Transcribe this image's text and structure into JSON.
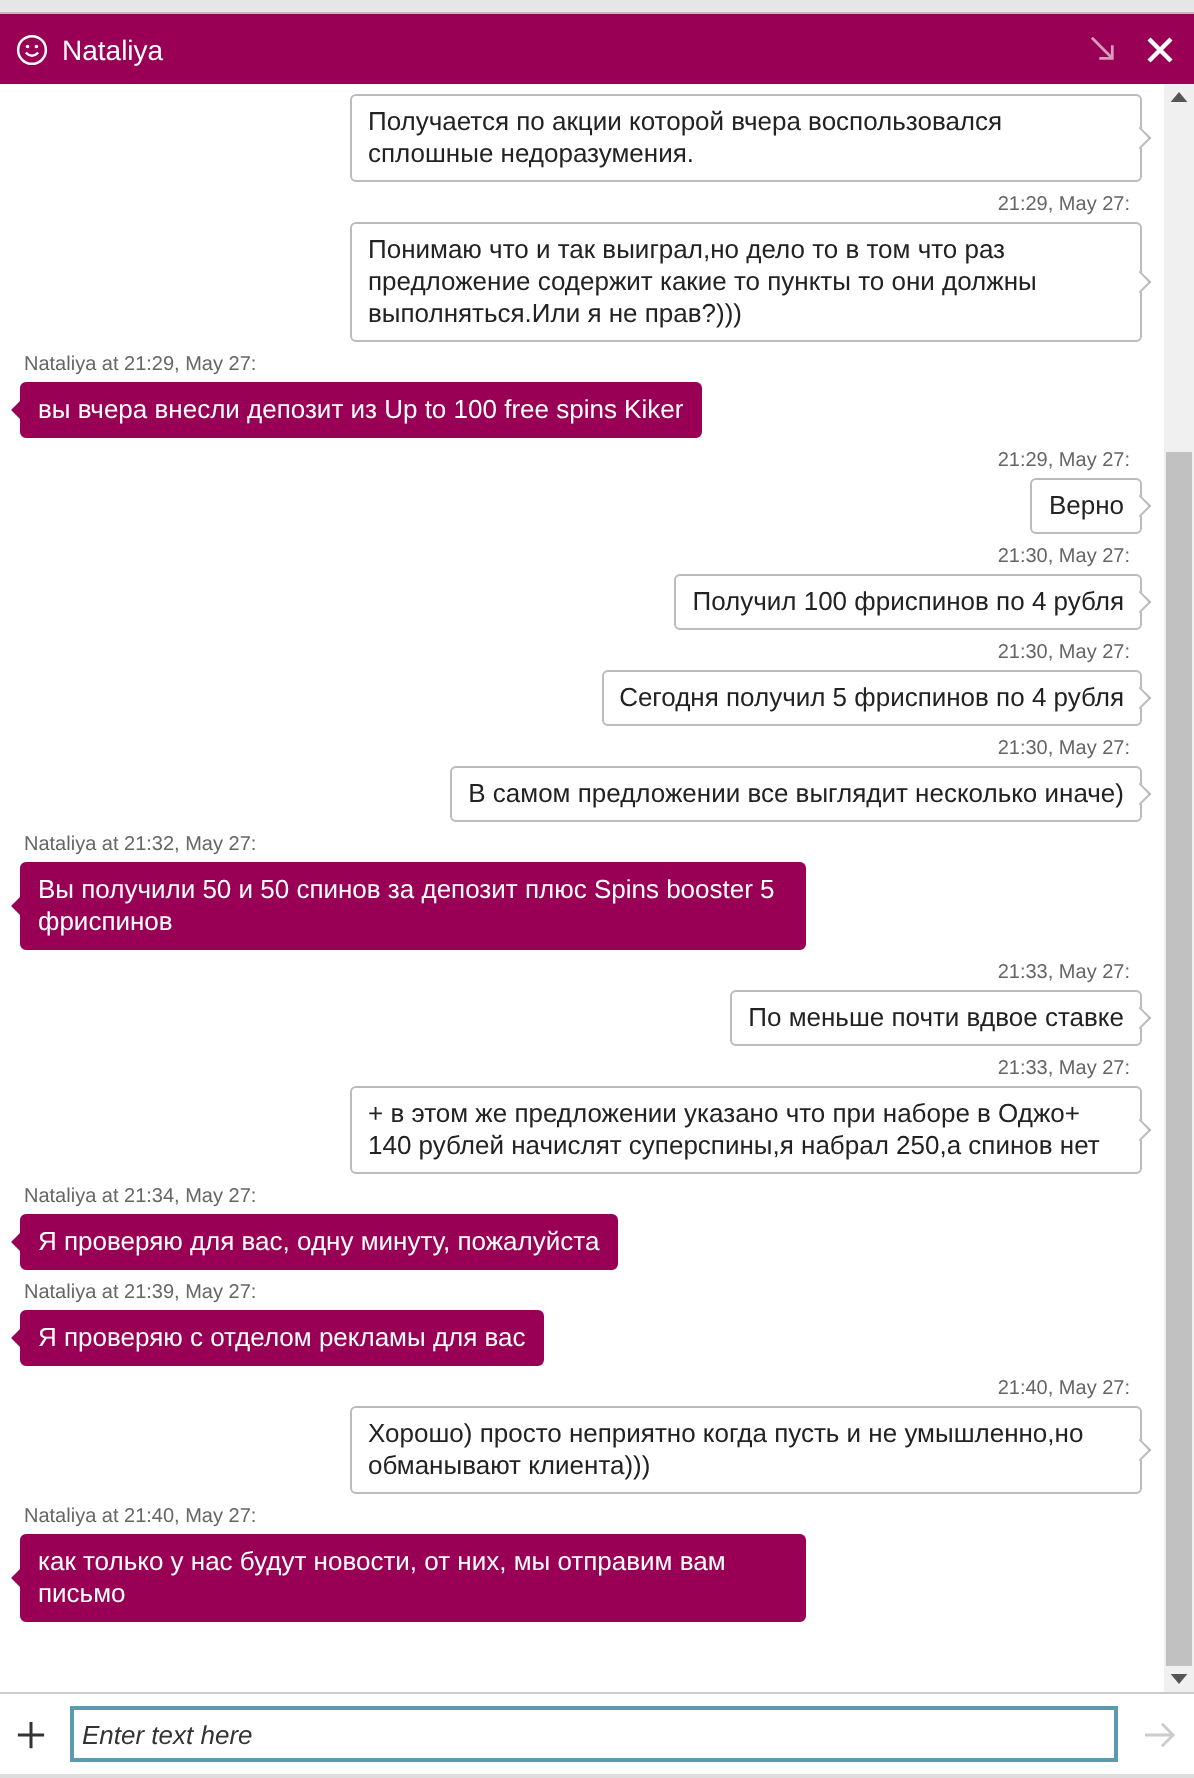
{
  "header": {
    "title": "Nataliya"
  },
  "messages": [
    {
      "kind": "user",
      "text": "Получается по акции которой вчера воспользовался сплошные недоразумения."
    },
    {
      "kind": "user",
      "time": "21:29, May 27:",
      "text": "Понимаю что и так выиграл,но дело то в том что раз предложение содержит какие то пункты то они должны выполняться.Или я не прав?)))"
    },
    {
      "kind": "agent",
      "time": "Nataliya at 21:29, May 27:",
      "text": "вы вчера внесли депозит из Up to 100 free spins Kiker"
    },
    {
      "kind": "user",
      "time": "21:29, May 27:",
      "text": "Верно"
    },
    {
      "kind": "user",
      "time": "21:30, May 27:",
      "text": "Получил 100 фриспинов по 4 рубля"
    },
    {
      "kind": "user",
      "time": "21:30, May 27:",
      "text": "Сегодня получил 5 фриспинов по 4 рубля"
    },
    {
      "kind": "user",
      "time": "21:30, May 27:",
      "text": "В самом предложении все выглядит несколько иначе)"
    },
    {
      "kind": "agent",
      "time": "Nataliya at 21:32, May 27:",
      "text": "Вы получили 50 и 50 спинов за депозит плюс Spins booster 5 фриспинов"
    },
    {
      "kind": "user",
      "time": "21:33, May 27:",
      "text": "По меньше почти вдвое ставке"
    },
    {
      "kind": "user",
      "time": "21:33, May 27:",
      "text": "+ в этом же предложении указано что при наборе в Оджо+ 140 рублей начислят суперспины,я набрал 250,а спинов нет"
    },
    {
      "kind": "agent",
      "time": "Nataliya at 21:34, May 27:",
      "text": "Я проверяю для вас, одну минуту, пожалуйста"
    },
    {
      "kind": "agent",
      "time": "Nataliya at 21:39, May 27:",
      "text": "Я проверяю с отделом рекламы для вас"
    },
    {
      "kind": "user",
      "time": "21:40, May 27:",
      "text": "Хорошо) просто неприятно когда пусть и не умышленно,но обманывают клиента)))"
    },
    {
      "kind": "agent",
      "time": "Nataliya at 21:40, May 27:",
      "text": "как только у нас будут новости, от них, мы отправим вам письмо"
    }
  ],
  "composer": {
    "placeholder": "Enter text here"
  }
}
